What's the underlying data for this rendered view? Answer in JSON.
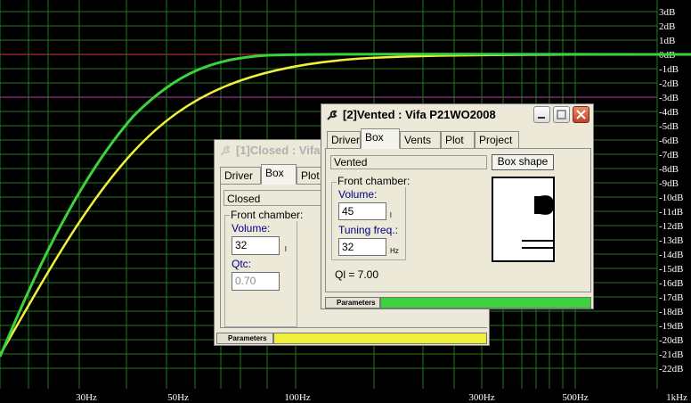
{
  "plot": {
    "y_labels": [
      "3dB",
      "2dB",
      "1dB",
      "0dB",
      "-1dB",
      "-2dB",
      "-3dB",
      "-4dB",
      "-5dB",
      "-6dB",
      "-7dB",
      "-8dB",
      "-9dB",
      "-10dB",
      "-11dB",
      "-12dB",
      "-13dB",
      "-14dB",
      "-15dB",
      "-16dB",
      "-17dB",
      "-18dB",
      "-19dB",
      "-20dB",
      "-21dB",
      "-22dB"
    ],
    "x_labels": [
      "30Hz",
      "50Hz",
      "100Hz",
      "300Hz",
      "500Hz",
      "1kHz"
    ],
    "colors": {
      "background": "#000000",
      "grid": "#1f7a1f",
      "zero_line": "#d23b3b",
      "minus3_line": "#b43cb4",
      "closed_curve": "#f0f03c",
      "vented_curve": "#3cd23c"
    }
  },
  "window_closed": {
    "title": "[1]Closed : Vifa",
    "tabs": [
      "Driver",
      "Box",
      "Plot"
    ],
    "box_type": "Closed",
    "front_chamber_label": "Front chamber:",
    "volume_label": "Volume:",
    "volume_value": "32",
    "volume_unit": "l",
    "qtc_label": "Qtc:",
    "qtc_value": "0.70",
    "status_label": "Parameters",
    "status_color": "#f0f03c"
  },
  "window_vented": {
    "title": "[2]Vented : Vifa P21WO2008",
    "tabs": [
      "Driver",
      "Box",
      "Vents",
      "Plot",
      "Project"
    ],
    "box_type": "Vented",
    "box_shape_button": "Box shape",
    "front_chamber_label": "Front chamber:",
    "volume_label": "Volume:",
    "volume_value": "45",
    "volume_unit": "l",
    "tuning_label": "Tuning freq.:",
    "tuning_value": "32",
    "tuning_unit": "Hz",
    "ql_text": "Ql = 7.00",
    "status_label": "Parameters",
    "status_color": "#3cd23c"
  }
}
